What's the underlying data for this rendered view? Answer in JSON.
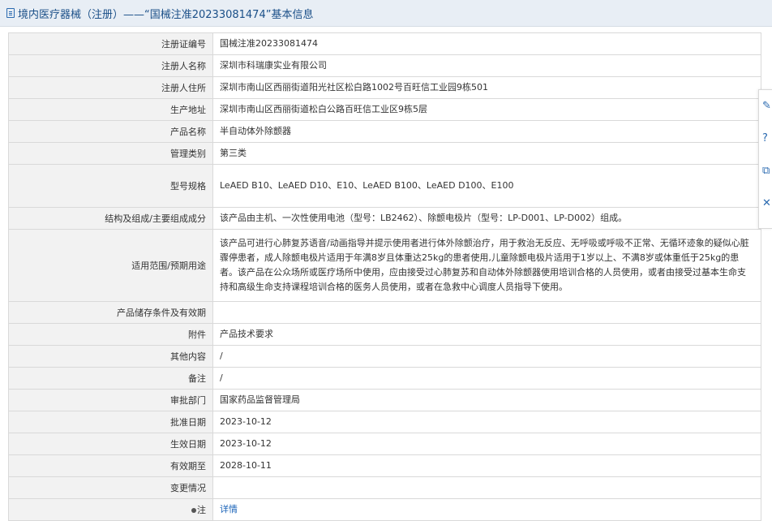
{
  "header": {
    "title": "境内医疗器械（注册）——“国械注准20233081474”基本信息"
  },
  "rows": [
    {
      "label": "注册证编号",
      "value": "国械注准20233081474"
    },
    {
      "label": "注册人名称",
      "value": "深圳市科瑞康实业有限公司"
    },
    {
      "label": "注册人住所",
      "value": "深圳市南山区西丽街道阳光社区松白路1002号百旺信工业园9栋501"
    },
    {
      "label": "生产地址",
      "value": "深圳市南山区西丽街道松白公路百旺信工业区9栋5层"
    },
    {
      "label": "产品名称",
      "value": "半自动体外除颤器"
    },
    {
      "label": "管理类别",
      "value": "第三类"
    },
    {
      "label": "型号规格",
      "value": "LeAED B10、LeAED D10、E10、LeAED B100、LeAED D100、E100"
    },
    {
      "label": "结构及组成/主要组成成分",
      "value": "该产品由主机、一次性使用电池（型号：LB2462）、除颤电极片（型号：LP-D001、LP-D002）组成。"
    },
    {
      "label": "适用范围/预期用途",
      "value": "该产品可进行心肺复苏语音/动画指导并提示使用者进行体外除颤治疗，用于救治无反应、无呼吸或呼吸不正常、无循环迹象的疑似心脏骤停患者，成人除颤电极片适用于年满8岁且体重达25kg的患者使用,儿童除颤电极片适用于1岁以上、不满8岁或体重低于25kg的患者。该产品在公众场所或医疗场所中使用，应由接受过心肺复苏和自动体外除颤器使用培训合格的人员使用，或者由接受过基本生命支持和高级生命支持课程培训合格的医务人员使用，或者在急救中心调度人员指导下使用。"
    },
    {
      "label": "产品储存条件及有效期",
      "value": ""
    },
    {
      "label": "附件",
      "value": "产品技术要求"
    },
    {
      "label": "其他内容",
      "value": "/"
    },
    {
      "label": "备注",
      "value": "/"
    },
    {
      "label": "审批部门",
      "value": "国家药品监督管理局"
    },
    {
      "label": "批准日期",
      "value": "2023-10-12"
    },
    {
      "label": "生效日期",
      "value": "2023-10-12"
    },
    {
      "label": "有效期至",
      "value": "2028-10-11"
    },
    {
      "label": "变更情况",
      "value": ""
    },
    {
      "label": "注",
      "value": "详情"
    }
  ],
  "icons": [
    "document-icon",
    "edit-icon",
    "help-icon",
    "copy-icon",
    "close-icon",
    "pin-icon"
  ]
}
